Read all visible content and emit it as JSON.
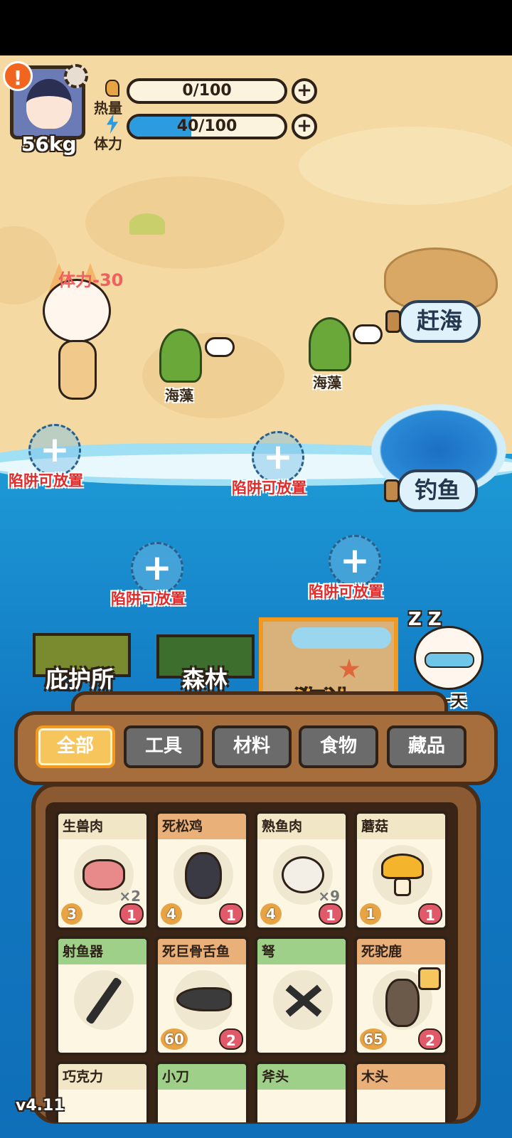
{
  "player": {
    "weight": "56kg"
  },
  "stats": {
    "calories": {
      "label": "热量",
      "current": 0,
      "max": 100,
      "text": "0/100",
      "fill": 0.0,
      "color": "#e8a345"
    },
    "stamina": {
      "label": "体力",
      "current": 40,
      "max": 100,
      "text": "40/100",
      "fill": 0.4,
      "color": "#2d9be0"
    }
  },
  "floating_text": "体力-30",
  "resources": [
    {
      "name": "海藻"
    },
    {
      "name": "海藻"
    }
  ],
  "actions": {
    "gather": "赶海",
    "fishing": "钓鱼",
    "next_day": "下一天",
    "sleep_mark": "Z Z"
  },
  "traps": [
    {
      "label": "陷阱可放置"
    },
    {
      "label": "陷阱可放置"
    },
    {
      "label": "陷阱可放置"
    },
    {
      "label": "陷阱可放置"
    }
  ],
  "locations": [
    {
      "name": "庇护所",
      "active": false
    },
    {
      "name": "森林",
      "active": false
    },
    {
      "name": "海边",
      "active": true
    }
  ],
  "tabs": [
    {
      "label": "全部",
      "active": true
    },
    {
      "label": "工具",
      "active": false
    },
    {
      "label": "材料",
      "active": false
    },
    {
      "label": "食物",
      "active": false
    },
    {
      "label": "藏品",
      "active": false
    }
  ],
  "items": [
    {
      "name": "生兽肉",
      "qty": "×2",
      "calories": "3",
      "weight": "1",
      "header_color": "#f1e6c6"
    },
    {
      "name": "死松鸡",
      "qty": "",
      "calories": "4",
      "weight": "1",
      "header_color": "#e9b07a"
    },
    {
      "name": "熟鱼肉",
      "qty": "×9",
      "calories": "4",
      "weight": "1",
      "header_color": "#f1e6c6"
    },
    {
      "name": "蘑菇",
      "qty": "",
      "calories": "1",
      "weight": "1",
      "header_color": "#f1e6c6"
    },
    {
      "name": "射鱼器",
      "qty": "",
      "calories": "",
      "weight": "",
      "header_color": "#9fd08a"
    },
    {
      "name": "死巨骨舌鱼",
      "qty": "",
      "calories": "60",
      "weight": "2",
      "header_color": "#e9b07a"
    },
    {
      "name": "弩",
      "qty": "",
      "calories": "",
      "weight": "",
      "header_color": "#9fd08a"
    },
    {
      "name": "死驼鹿",
      "qty": "",
      "calories": "65",
      "weight": "2",
      "header_color": "#e9b07a"
    },
    {
      "name": "巧克力",
      "header_color": "#f1e6c6"
    },
    {
      "name": "小刀",
      "header_color": "#9fd08a"
    },
    {
      "name": "斧头",
      "header_color": "#9fd08a"
    },
    {
      "name": "木头",
      "header_color": "#e9b07a"
    }
  ],
  "version": "v4.11",
  "colors": {
    "sand": "#f4d9a2",
    "sea": "#1a8fd0",
    "accent": "#f29a1f",
    "trap_text": "#e12b2b"
  }
}
